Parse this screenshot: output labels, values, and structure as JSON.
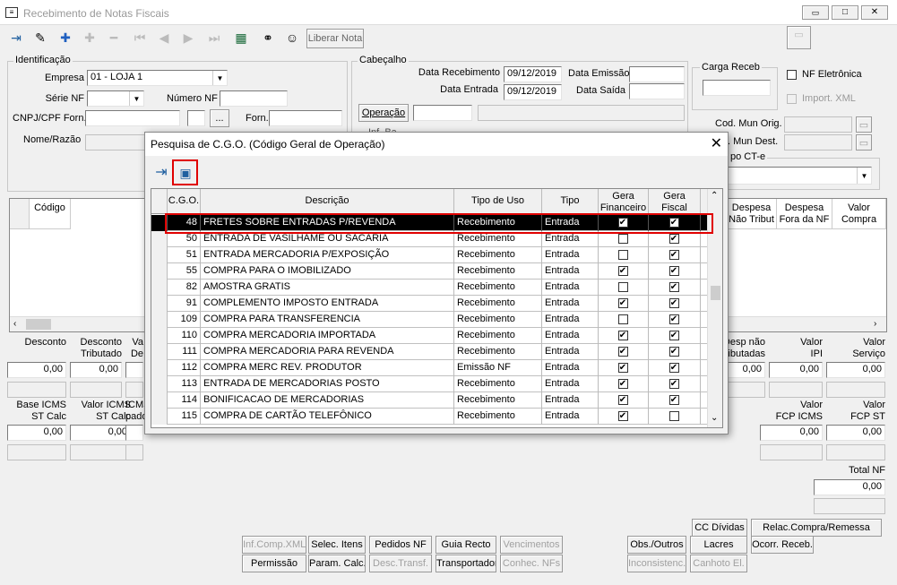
{
  "window": {
    "title": "Recebimento de Notas Fiscais",
    "min": "▭",
    "max": "□",
    "close": "✕"
  },
  "toolbar": {
    "liberar": "Liberar Nota"
  },
  "ident": {
    "group": "Identificação",
    "empresa_label": "Empresa",
    "empresa_value": "01 - LOJA    1",
    "serie_label": "Série NF",
    "numero_label": "Número NF",
    "cnpj_label": "CNPJ/CPF Forn.",
    "forn_label": "Forn.",
    "razao_label": "Nome/Razão",
    "ellipsis": "..."
  },
  "cab": {
    "group": "Cabeçalho",
    "data_receb_label": "Data Recebimento",
    "data_receb": "09/12/2019",
    "data_emissao_label": "Data Emissão",
    "data_entrada_label": "Data Entrada",
    "data_entrada": "09/12/2019",
    "data_saida_label": "Data Saída",
    "operacao": "Operação",
    "carga": "Carga Receb",
    "nf_eletronica": "NF Eletrônica",
    "import_xml": "Import. XML",
    "cod_mun_orig": "Cod. Mun Orig.",
    "mun_dest": ". Mun Dest.",
    "tipo_cte": "po CT-e",
    "partial": "Inf..Ba."
  },
  "grid": {
    "codigo": "Código",
    "despesa_nao_trib": "Despesa\nNão Tribut",
    "despesa_fora": "Despesa\nFora da NF",
    "valor_compra": "Valor\nCompra"
  },
  "totais": {
    "r1": [
      {
        "label": "Desconto",
        "value": "0,00"
      },
      {
        "label": "Desconto\nTributado",
        "value": "0,00"
      },
      {
        "label": "Va\nDe",
        "value": ""
      },
      {
        "label": "Desp não\nTributadas",
        "value": "0,00"
      },
      {
        "label": "Valor\nIPI",
        "value": "0,00"
      },
      {
        "label": "Valor\nServiço",
        "value": "0,00"
      }
    ],
    "r2": [
      {
        "label": "Base ICMS\nST Calc",
        "value": "0,00"
      },
      {
        "label": "Valor ICMS\nST Calc",
        "value": "0,00"
      },
      {
        "label": "ICMS\npado",
        "value": ""
      },
      {
        "label": "Valor\nFCP ICMS",
        "value": "0,00"
      },
      {
        "label": "Valor\nFCP ST",
        "value": "0,00"
      }
    ],
    "total_nf_label": "Total NF",
    "total_nf": "0,00"
  },
  "buttons": {
    "inf_comp_xml": "Inf.Comp.XML",
    "selec_itens": "Selec. Itens",
    "pedidos_nf": "Pedidos NF",
    "guia_recto": "Guia Recto",
    "vencimentos": "Vencimentos",
    "obs_outros": "Obs./Outros",
    "lacres": "Lacres",
    "ocorr_receb": "Ocorr. Receb.",
    "cc_dividas": "CC Dívidas",
    "relac_compra": "Relac.Compra/Remessa",
    "permissao": "Permissão",
    "param_calc": "Param. Calc.",
    "desc_transf": "Desc.Transf.",
    "transportador": "Transportador",
    "conhec_nfs": "Conhec. NFs",
    "inconsistenc": "Inconsistenc.",
    "canhoto": "Canhoto El."
  },
  "dialog": {
    "title": "Pesquisa de C.G.O. (Código Geral de Operação)",
    "close": "✕",
    "headers": {
      "cgo": "C.G.O.",
      "descricao": "Descrição",
      "tipo_uso": "Tipo de Uso",
      "tipo": "Tipo",
      "gera_fin": "Gera\nFinanceiro",
      "gera_fis": "Gera\nFiscal"
    },
    "rows": [
      {
        "cgo": "48",
        "desc": "FRETES SOBRE ENTRADAS P/REVENDA",
        "uso": "Recebimento",
        "tipo": "Entrada",
        "fin": true,
        "fis": true
      },
      {
        "cgo": "50",
        "desc": "ENTRADA DE VASILHAME OU SACARIA",
        "uso": "Recebimento",
        "tipo": "Entrada",
        "fin": false,
        "fis": true
      },
      {
        "cgo": "51",
        "desc": "ENTRADA MERCADORIA P/EXPOSIÇÃO",
        "uso": "Recebimento",
        "tipo": "Entrada",
        "fin": false,
        "fis": true
      },
      {
        "cgo": "55",
        "desc": "COMPRA PARA O IMOBILIZADO",
        "uso": "Recebimento",
        "tipo": "Entrada",
        "fin": true,
        "fis": true
      },
      {
        "cgo": "82",
        "desc": "AMOSTRA GRATIS",
        "uso": "Recebimento",
        "tipo": "Entrada",
        "fin": false,
        "fis": true
      },
      {
        "cgo": "91",
        "desc": "COMPLEMENTO IMPOSTO ENTRADA",
        "uso": "Recebimento",
        "tipo": "Entrada",
        "fin": true,
        "fis": true
      },
      {
        "cgo": "109",
        "desc": "COMPRA PARA TRANSFERENCIA",
        "uso": "Recebimento",
        "tipo": "Entrada",
        "fin": false,
        "fis": true
      },
      {
        "cgo": "110",
        "desc": "COMPRA MERCADORIA IMPORTADA",
        "uso": "Recebimento",
        "tipo": "Entrada",
        "fin": true,
        "fis": true
      },
      {
        "cgo": "111",
        "desc": "COMPRA MERCADORIA PARA REVENDA",
        "uso": "Recebimento",
        "tipo": "Entrada",
        "fin": true,
        "fis": true
      },
      {
        "cgo": "112",
        "desc": "COMPRA MERC REV. PRODUTOR",
        "uso": "Emissão NF",
        "tipo": "Entrada",
        "fin": true,
        "fis": true
      },
      {
        "cgo": "113",
        "desc": "ENTRADA DE MERCADORIAS POSTO",
        "uso": "Recebimento",
        "tipo": "Entrada",
        "fin": true,
        "fis": true
      },
      {
        "cgo": "114",
        "desc": "BONIFICACAO DE MERCADORIAS",
        "uso": "Recebimento",
        "tipo": "Entrada",
        "fin": true,
        "fis": true
      },
      {
        "cgo": "115",
        "desc": "COMPRA DE CARTÃO TELEFÔNICO",
        "uso": "Recebimento",
        "tipo": "Entrada",
        "fin": true,
        "fis": false
      }
    ]
  },
  "colors": {
    "highlight": "#e00000",
    "selected_row": "#000000"
  }
}
